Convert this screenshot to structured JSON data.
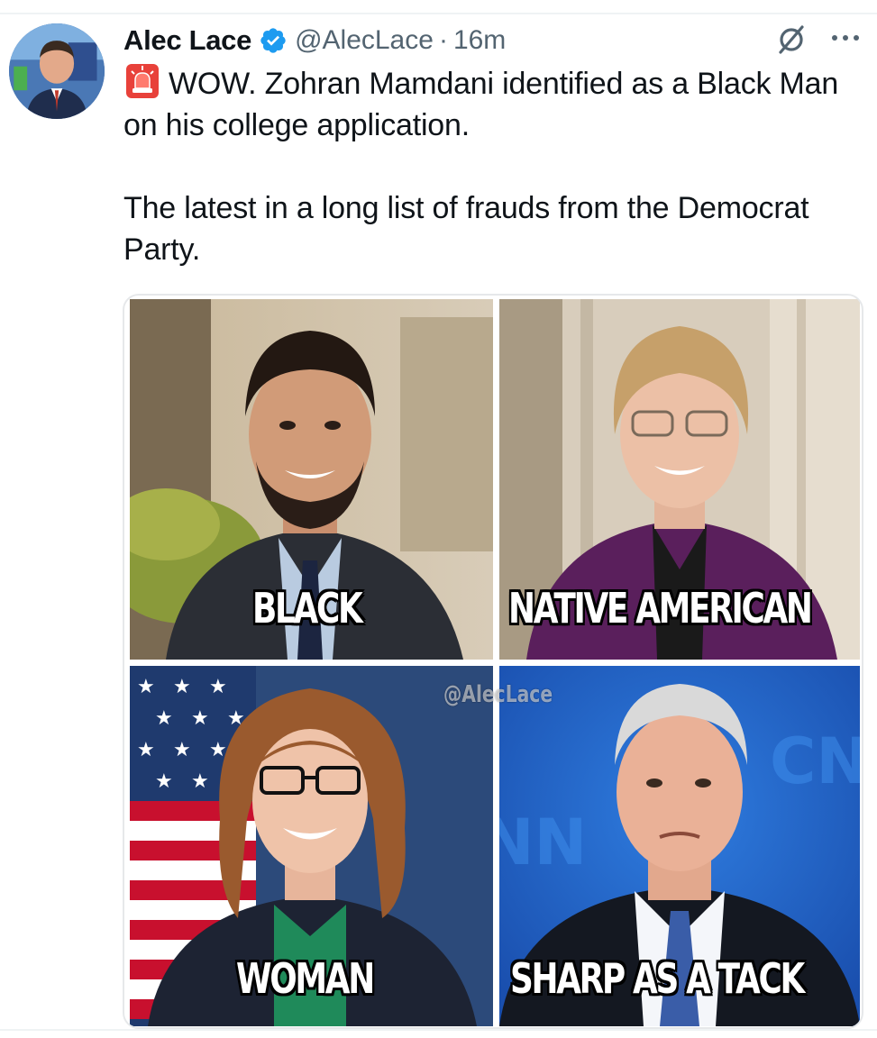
{
  "author": {
    "name": "Alec Lace",
    "handle": "@AlecLace",
    "separator": "·",
    "time": "16m",
    "avatar_icon": "avatar-photo"
  },
  "tweet": {
    "line1": "WOW. Zohran Mamdani identified as a Black Man on his college application.",
    "line2": "The latest in a long list of frauds from the Democrat Party.",
    "emoji_icon": "siren-icon"
  },
  "media": {
    "watermark": "@AlecLace",
    "captions": [
      "BLACK",
      "NATIVE AMERICAN",
      "WOMAN",
      "SHARP AS A TACK"
    ]
  },
  "colors": {
    "verified": "#1d9bf0",
    "text": "#0f1419",
    "secondary": "#536471"
  }
}
